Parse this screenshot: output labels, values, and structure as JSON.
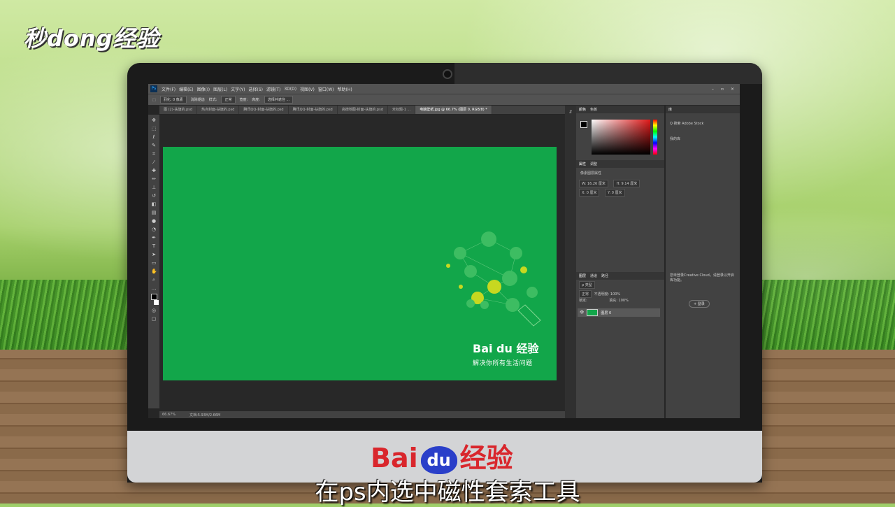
{
  "overlay": {
    "logo": "秒dong经验",
    "subtitle": "在ps内选中磁性套索工具",
    "chin_logo_left": "Bai",
    "chin_logo_du": "du",
    "chin_logo_right": "经验"
  },
  "app": {
    "icon": "Ps",
    "menu": [
      "文件(F)",
      "编辑(E)",
      "图像(I)",
      "图层(L)",
      "文字(Y)",
      "选择(S)",
      "滤镜(T)",
      "3D(D)",
      "视图(V)",
      "窗口(W)",
      "帮助(H)"
    ],
    "window_controls": [
      "–",
      "▫",
      "×"
    ],
    "options": {
      "feather": "羽化: 0 像素",
      "antialias": "消除锯齿",
      "style_label": "样式:",
      "style_value": "正常",
      "width": "宽度:",
      "height": "高度:",
      "select_mask": "选择并遮住 ..."
    },
    "tabs": [
      {
        "label": "图 (2)-扶旗的.psd",
        "active": false
      },
      {
        "label": "热点封面-扶旗的.psd",
        "active": false
      },
      {
        "label": "腾讯QQ-封面-扶旗的.psd",
        "active": false
      },
      {
        "label": "腾讯QQ-封面-扶旗的.psd",
        "active": false
      },
      {
        "label": "高德地图-封面-扶旗的.psd",
        "active": false
      },
      {
        "label": "未标题-1 ...",
        "active": false
      },
      {
        "label": "电脑壁纸.jpg @ 66.7% (图层 0, RGB/8) *",
        "active": true
      }
    ],
    "canvas": {
      "brand": "Bai du 经验",
      "slogan": "解决你所有生活问题",
      "background": "#12a64a"
    },
    "status": {
      "zoom": "66.67%",
      "doc": "文档:5.93M/2.66M"
    },
    "color_panel": {
      "tabs": [
        "颜色",
        "色板"
      ]
    },
    "properties_panel": {
      "tabs": [
        "属性",
        "调整"
      ],
      "title": "像素图层属性",
      "w": "W: 16.26 厘米",
      "h": "H: 9.14 厘米",
      "x": "X: 0 厘米",
      "y": "Y: 0 厘米"
    },
    "layers_panel": {
      "tabs": [
        "图层",
        "通道",
        "路径"
      ],
      "kind": "ρ 类型",
      "blend": "正常",
      "opacity": "不透明度: 100%",
      "lock": "锁定:",
      "fill": "填充: 100%",
      "layer_name": "图层 0"
    },
    "libraries_panel": {
      "tabs": [
        "库"
      ],
      "search": "Q 搜索 Adobe Stock",
      "library": "我的库",
      "message": "您未登录Creative Cloud。请登录以开启库功能。",
      "signin": "+ 登录"
    }
  }
}
